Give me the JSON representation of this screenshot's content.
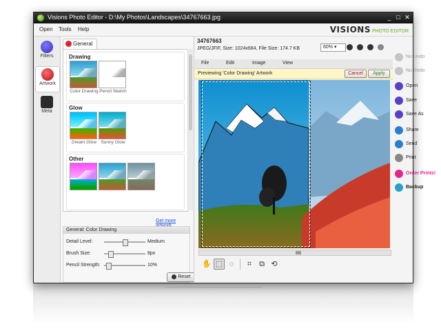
{
  "window": {
    "title": "Visions Photo Editor - D:\\My Photos\\Landscapes\\34767663.jpg",
    "controls": [
      "_",
      "□",
      "✕"
    ]
  },
  "menu": [
    "Open",
    "Tools",
    "Help"
  ],
  "logo": {
    "brand": "VISIONS",
    "sub": "PHOTO EDITOR"
  },
  "leftnav": [
    {
      "label": "Filters",
      "icon": "filters-icon",
      "color": "#4a3fcf"
    },
    {
      "label": "Artwork",
      "icon": "artwork-icon",
      "color": "#d41a2a"
    },
    {
      "label": "Meta",
      "icon": "meta-icon",
      "color": "#2a2a2a"
    }
  ],
  "panel": {
    "tab": "General",
    "groups": [
      {
        "title": "Drawing",
        "items": [
          "Color Drawing",
          "Pencil Sketch"
        ]
      },
      {
        "title": "Glow",
        "items": [
          "Dream Glow",
          "Sunny Glow"
        ]
      },
      {
        "title": "Other",
        "items": [
          "",
          "",
          ""
        ]
      }
    ],
    "more_link": "Get more artwork...",
    "settings": {
      "header": "General: Color Drawing",
      "rows": [
        {
          "label": "Detail Level:",
          "value": "Medium",
          "level": 0.5
        },
        {
          "label": "Brush Size:",
          "value": "8px",
          "level": 0.15
        },
        {
          "label": "Pencil Strength:",
          "value": "10%",
          "level": 0.1
        }
      ],
      "reset": "Reset"
    }
  },
  "image": {
    "name": "34767663",
    "info": "JPEG/JFIF, Size: 1024x684, File Size: 174.7 KB",
    "zoom": "60%",
    "menu": [
      "File",
      "Edit",
      "Image",
      "View"
    ],
    "preview_text": "Previewing 'Color Drawing' Artwork",
    "cancel": "Cancel",
    "apply": "Apply"
  },
  "tools": [
    "hand-tool",
    "rect-select-tool",
    "ellipse-select-tool",
    "crop-tool",
    "resize-tool",
    "rotate-tool"
  ],
  "actions": [
    {
      "label": "No Undo",
      "color": "#b5b5b5",
      "enabled": false
    },
    {
      "label": "No Redo",
      "color": "#b5b5b5",
      "enabled": false
    },
    {
      "label": "Open",
      "color": "#5a3fc8",
      "enabled": true
    },
    {
      "label": "Save",
      "color": "#5a3fc8",
      "enabled": true
    },
    {
      "label": "Save As",
      "color": "#5a3fc8",
      "enabled": true
    },
    {
      "label": "Share",
      "color": "#2a7fd2",
      "enabled": true
    },
    {
      "label": "Send",
      "color": "#2a7fd2",
      "enabled": true
    },
    {
      "label": "Print",
      "color": "#888888",
      "enabled": true
    },
    {
      "label": "Order Prints!",
      "color": "#e0288c",
      "enabled": true
    },
    {
      "label": "Backup",
      "color": "#2aa0c8",
      "enabled": true
    }
  ]
}
